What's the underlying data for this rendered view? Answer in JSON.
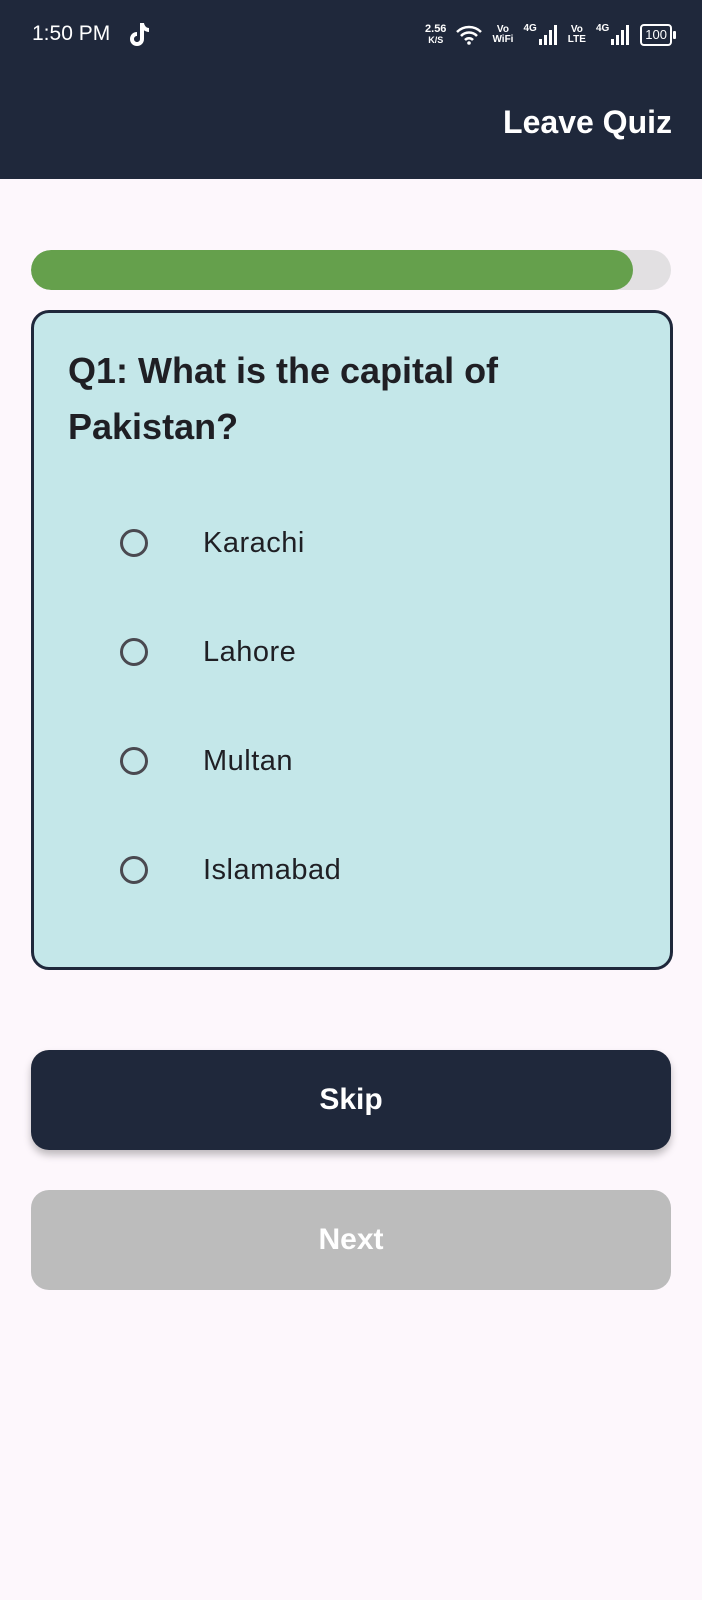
{
  "status_bar": {
    "time": "1:50 PM",
    "net_speed_value": "2.56",
    "net_speed_unit": "K/S",
    "vowifi_top": "Vo",
    "vowifi_bottom": "WiFi",
    "sim1_tech": "4G",
    "volte_top": "Vo",
    "volte_bottom": "LTE",
    "sim2_tech": "4G",
    "battery": "100"
  },
  "header": {
    "leave_label": "Leave Quiz"
  },
  "progress": {
    "fraction": 0.94,
    "fill_color": "#65a04c",
    "track_color": "#e2e0e2"
  },
  "quiz": {
    "question": "Q1: What is the capital of Pakistan?",
    "options": [
      {
        "label": "Karachi",
        "selected": false
      },
      {
        "label": "Lahore",
        "selected": false
      },
      {
        "label": "Multan",
        "selected": false
      },
      {
        "label": "Islamabad",
        "selected": false
      }
    ]
  },
  "buttons": {
    "skip_label": "Skip",
    "next_label": "Next"
  },
  "colors": {
    "header_bg": "#1f283b",
    "card_bg": "#c4e7e9",
    "disabled_button": "#bcbcbc"
  }
}
